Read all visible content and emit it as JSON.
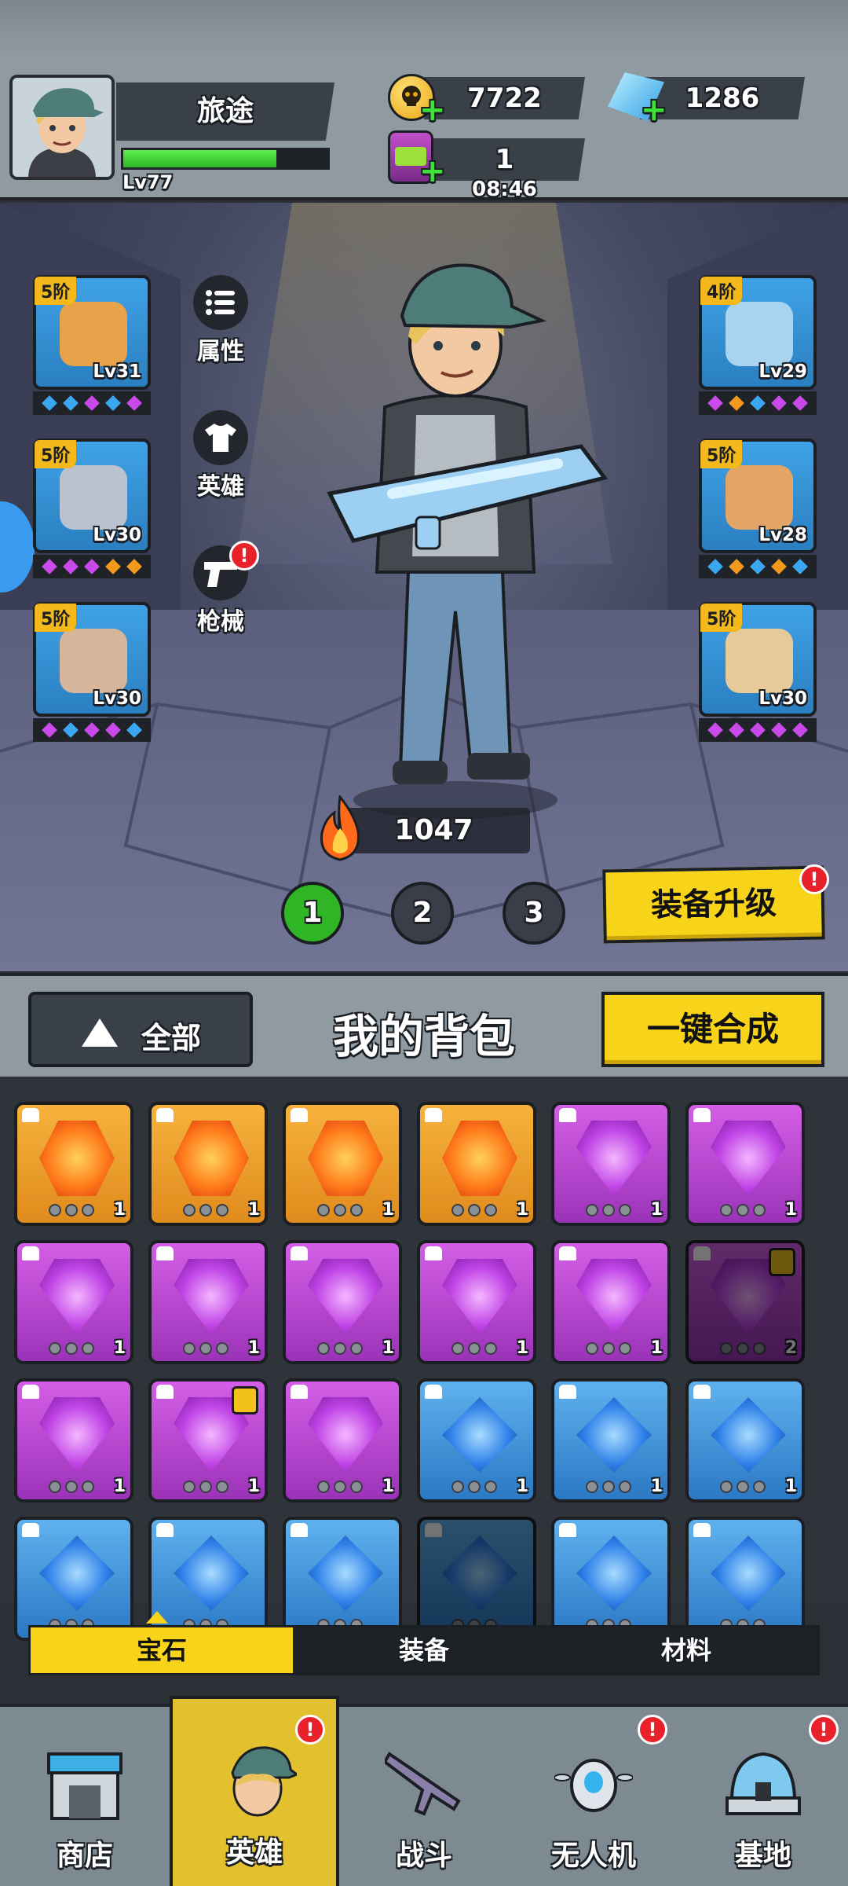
{
  "player": {
    "name": "旅途",
    "level": "Lv77",
    "xp_fraction": 0.75
  },
  "resources": {
    "gold": "7722",
    "gems": "1286",
    "energy": "1",
    "energy_timer": "08:46"
  },
  "side_menu": {
    "attributes": "属性",
    "hero": "英雄",
    "firearms": "枪械",
    "firearms_badge": "!"
  },
  "equipment_left": [
    {
      "tier": "5阶",
      "level": "Lv31",
      "kind": "helmet-icon",
      "gem_colors": [
        "#3aa8f0",
        "#3aa8f0",
        "#c94ae8",
        "#3aa8f0",
        "#c94ae8"
      ]
    },
    {
      "tier": "5阶",
      "level": "Lv30",
      "kind": "armor-icon",
      "gem_colors": [
        "#c94ae8",
        "#c94ae8",
        "#c94ae8",
        "#f29a1d",
        "#f29a1d"
      ]
    },
    {
      "tier": "5阶",
      "level": "Lv30",
      "kind": "boots-icon",
      "gem_colors": [
        "#c94ae8",
        "#3aa8f0",
        "#c94ae8",
        "#c94ae8",
        "#3aa8f0"
      ]
    }
  ],
  "equipment_right": [
    {
      "tier": "4阶",
      "level": "Lv29",
      "kind": "capsule-icon",
      "gem_colors": [
        "#c94ae8",
        "#f29a1d",
        "#3aa8f0",
        "#c94ae8",
        "#c94ae8"
      ]
    },
    {
      "tier": "5阶",
      "level": "Lv28",
      "kind": "pants-icon",
      "gem_colors": [
        "#3aa8f0",
        "#f29a1d",
        "#3aa8f0",
        "#f29a1d",
        "#3aa8f0"
      ]
    },
    {
      "tier": "5阶",
      "level": "Lv30",
      "kind": "gloves-icon",
      "gem_colors": [
        "#c94ae8",
        "#c94ae8",
        "#c94ae8",
        "#c94ae8",
        "#c94ae8"
      ]
    }
  ],
  "power": "1047",
  "loadout_pages": [
    "1",
    "2",
    "3"
  ],
  "upgrade_button": "装备升级",
  "upgrade_badge": "!",
  "bag": {
    "filter": "全部",
    "title": "我的背包",
    "merge_button": "一键合成"
  },
  "bag_items": [
    {
      "color": "orange",
      "count": "1"
    },
    {
      "color": "orange",
      "count": "1"
    },
    {
      "color": "orange",
      "count": "1"
    },
    {
      "color": "orange",
      "count": "1"
    },
    {
      "color": "purple",
      "count": "1"
    },
    {
      "color": "purple",
      "count": "1"
    },
    {
      "color": "purple",
      "count": "1"
    },
    {
      "color": "purple",
      "count": "1"
    },
    {
      "color": "purple",
      "count": "1"
    },
    {
      "color": "purple",
      "count": "1"
    },
    {
      "color": "purple",
      "count": "1"
    },
    {
      "color": "purple",
      "count": "2",
      "locked": true,
      "dim": true
    },
    {
      "color": "purple",
      "count": "1"
    },
    {
      "color": "purple",
      "count": "1",
      "locked": true
    },
    {
      "color": "purple",
      "count": "1"
    },
    {
      "color": "blue",
      "count": "1"
    },
    {
      "color": "blue",
      "count": "1"
    },
    {
      "color": "blue",
      "count": "1"
    },
    {
      "color": "blue",
      "count": ""
    },
    {
      "color": "blue",
      "count": ""
    },
    {
      "color": "blue",
      "count": ""
    },
    {
      "color": "blue",
      "count": "",
      "dim": true
    },
    {
      "color": "blue",
      "count": ""
    },
    {
      "color": "blue",
      "count": ""
    }
  ],
  "bag_tabs": [
    "宝石",
    "装备",
    "材料"
  ],
  "nav": [
    {
      "label": "商店",
      "icon": "shop-icon",
      "badge": ""
    },
    {
      "label": "英雄",
      "icon": "hero-icon",
      "badge": "!"
    },
    {
      "label": "战斗",
      "icon": "rifle-icon",
      "badge": ""
    },
    {
      "label": "无人机",
      "icon": "drone-icon",
      "badge": "!"
    },
    {
      "label": "基地",
      "icon": "base-icon",
      "badge": "!"
    }
  ]
}
